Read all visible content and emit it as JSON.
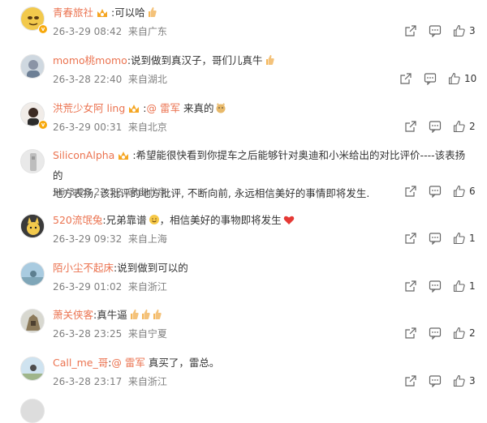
{
  "comments": [
    {
      "user": "青春旅社",
      "text": ":可以哈",
      "time": "26-3-29 08:42",
      "location": "来自广东",
      "likes": "3"
    },
    {
      "user": "momo桃momo",
      "text": ":说到做到真汉子，哥们儿真牛",
      "time": "26-3-28 22:40",
      "location": "来自湖北",
      "likes": "10"
    },
    {
      "user": "洪荒少女阿 ling",
      "mention": "@ 雷军",
      "text": " 来真的",
      "time": "26-3-29 00:31",
      "location": "来自北京",
      "likes": "2"
    },
    {
      "user": "SiliconAlpha",
      "text": ":希望能很快看到你提车之后能够针对奥迪和小米给出的对比评价----该表扬的",
      "text2": "地方表扬, 该批评的地方批评, 不断向前, 永远相信美好的事情即将发生.",
      "time": "26-3-28 22:52",
      "location": "来自北京",
      "likes": "6"
    },
    {
      "user": "520流氓兔",
      "text": ":兄弟靠谱",
      "text_b": "，相信美好的事物即将发生",
      "time": "26-3-29 09:32",
      "location": "来自上海",
      "likes": "1"
    },
    {
      "user": "陌小尘不起床",
      "text": ":说到做到可以的",
      "time": "26-3-29 01:02",
      "location": "来自浙江",
      "likes": "1"
    },
    {
      "user": "萧关侠客",
      "text": ":真牛逼",
      "time": "26-3-28 23:25",
      "location": "来自宁夏",
      "likes": "2"
    },
    {
      "user": "Call_me_哥",
      "mention": "@ 雷军",
      "text": " 真买了，雷总。",
      "time": "26-3-28 23:17",
      "location": "来自浙江",
      "likes": "3"
    }
  ],
  "icons": {
    "share": "share-icon",
    "comment": "comment-icon",
    "like": "thumbs-up-icon"
  },
  "colors": {
    "username": "#eb7350",
    "meta": "#808080",
    "badge": "#f7a90d"
  }
}
